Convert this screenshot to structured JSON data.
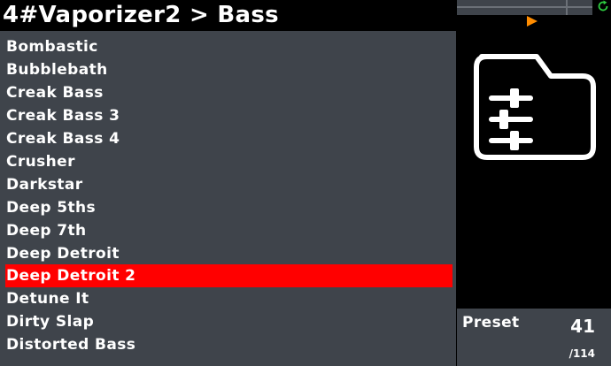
{
  "header": {
    "title": "4#Vaporizer2 > Bass"
  },
  "preset_list": {
    "items": [
      "Bombastic",
      "Bubblebath",
      "Creak Bass",
      "Creak Bass 3",
      "Creak Bass 4",
      "Crusher",
      "Darkstar",
      "Deep 5ths",
      "Deep 7th",
      "Deep Detroit",
      "Deep Detroit 2",
      "Detune It",
      "Dirty Slap",
      "Distorted Bass"
    ],
    "selected_index": 10
  },
  "status": {
    "preset_label": "Preset",
    "preset_number": "41",
    "preset_total": "/114"
  },
  "icons": {
    "refresh": "refresh-icon",
    "play": "play-icon",
    "folder": "folder-sliders-icon"
  },
  "colors": {
    "selected_row": "#ff0000",
    "play_arrow": "#ff8c00",
    "refresh": "#2ecc40"
  }
}
